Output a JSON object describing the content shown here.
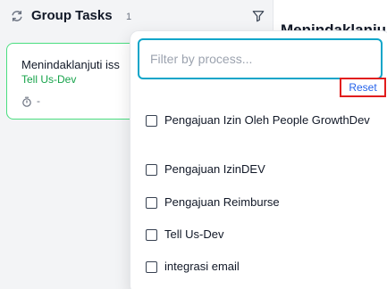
{
  "header": {
    "title": "Group Tasks",
    "count": "1"
  },
  "task": {
    "title": "Menindaklanjuti iss",
    "process": "Tell Us-Dev",
    "due": "-"
  },
  "detail": {
    "title": "Menindaklanju"
  },
  "filter": {
    "placeholder": "Filter by process...",
    "value": "",
    "reset_label": "Reset",
    "options": [
      "Pengajuan Izin Oleh People GrowthDev",
      "Pengajuan IzinDEV",
      "Pengajuan Reimburse",
      "Tell Us-Dev",
      "integrasi email"
    ]
  },
  "colors": {
    "accent": "#0ea5c9",
    "success": "#16a34a",
    "reset_highlight": "#e11d1d",
    "link": "#2563eb"
  },
  "icons": {
    "refresh": "refresh-icon",
    "filter": "filter-icon",
    "timer": "timer-icon"
  }
}
